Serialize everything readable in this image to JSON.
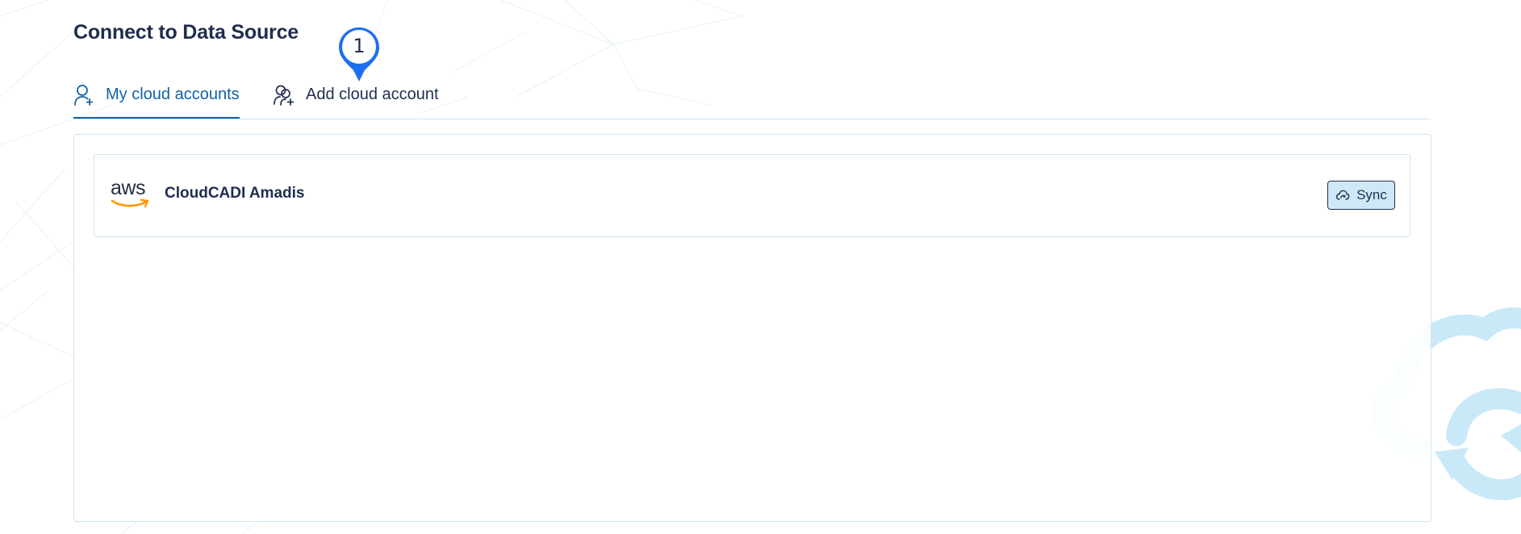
{
  "page": {
    "title": "Connect to Data Source"
  },
  "step_marker": {
    "number": "1",
    "color": "#1e6ef0"
  },
  "tabs": [
    {
      "label": "My cloud accounts",
      "icon": "user-plus-icon",
      "active": true
    },
    {
      "label": "Add cloud account",
      "icon": "users-plus-icon",
      "active": false
    }
  ],
  "accounts": [
    {
      "provider_logo_text": "aws",
      "name": "CloudCADI Amadis",
      "sync_label": "Sync",
      "sync_icon": "cloud-sync-icon"
    }
  ],
  "colors": {
    "title": "#1f2d4f",
    "accent": "#0f63a8",
    "border": "#cfe6f3",
    "sync_bg": "#cde9f8",
    "aws_orange": "#ff9900",
    "illustration": "#c9e9f8"
  }
}
